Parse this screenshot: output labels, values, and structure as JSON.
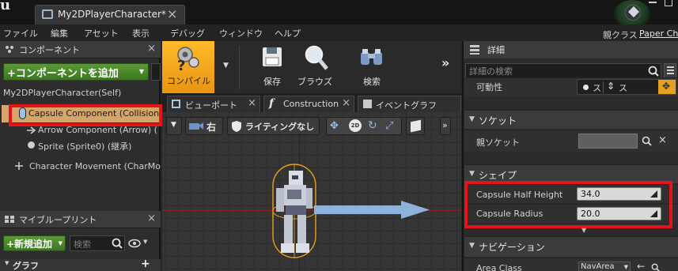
{
  "window": {
    "tab_title": "My2DPlayerCharacter*",
    "parent_class_label": "親クラス",
    "parent_class_value": "Paper Ch"
  },
  "menubar": [
    "ファイル",
    "編集",
    "アセット",
    "表示",
    "デバッグ",
    "ウィンドウ",
    "ヘルプ"
  ],
  "components_panel": {
    "title": "コンポーネント",
    "add_button": "+コンポーネントを追加",
    "self_item": "My2DPlayerCharacter(Self)",
    "items": [
      "Capsule Component (Collision",
      "Arrow Component (Arrow) (",
      "Sprite (Sprite0) (継承)",
      "Character Movement (CharMo"
    ]
  },
  "blueprint_panel": {
    "title": "マイブループリント",
    "new_button": "+新規追加",
    "search_placeholder": "検索",
    "graph_section": "グラフ"
  },
  "toolbar": {
    "compile": "コンパイル",
    "save": "保存",
    "browse": "ブラウズ",
    "find": "検索"
  },
  "editor_tabs": [
    "ビューポート",
    "Construction",
    "イベントグラフ"
  ],
  "viewport_toolbar": {
    "view_button": "右",
    "lighting_button": "ライティングなし"
  },
  "details": {
    "title": "詳細",
    "search_placeholder": "詳細の検索",
    "mobility_label": "可動性",
    "mobility_options": [
      "ス",
      "ス"
    ],
    "socket_category": "ソケット",
    "parent_socket_label": "親ソケット",
    "shape_category": "シェイプ",
    "capsule_half_height_label": "Capsule Half Height",
    "capsule_half_height_value": "34.0",
    "capsule_radius_label": "Capsule Radius",
    "capsule_radius_value": "20.0",
    "navigation_category": "ナビゲーション",
    "area_class_label": "Area Class",
    "area_class_value": "NavArea"
  },
  "colors": {
    "highlight_red": "#e4141b",
    "selection_orange": "#d6a56a",
    "compile_orange": "#f5a623",
    "add_green": "#4c8a2b"
  }
}
